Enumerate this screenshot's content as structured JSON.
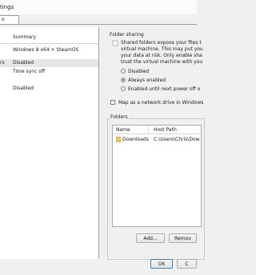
{
  "window": {
    "title": "tings"
  },
  "tabs": [
    {
      "label": "o"
    }
  ],
  "left_panel": {
    "header": "Summary",
    "rows": [
      {
        "key": "",
        "value": "Windows 8 x64 + SteamOS"
      },
      {
        "key": "rs",
        "value": "Disabled"
      },
      {
        "key": "",
        "value": "Time sync off"
      },
      {
        "key": "",
        "value": "Disabled"
      }
    ]
  },
  "folder_sharing": {
    "title": "Folder sharing",
    "description": [
      "Shared folders expose your files t",
      "virtual machine. This may put you",
      "your data at risk. Only enable sha",
      "trust the virtual machine with you"
    ],
    "options": [
      {
        "label": "Disabled",
        "selected": false
      },
      {
        "label": "Always enabled",
        "selected": true
      },
      {
        "label": "Enabled until next power off o",
        "selected": false
      }
    ],
    "map_network_drive": {
      "label": "Map as a network drive in Windows",
      "checked": false
    }
  },
  "folders": {
    "title": "Folders",
    "columns": [
      "Name",
      "Host Path"
    ],
    "rows": [
      {
        "name": "Downloads",
        "host_path": "C:\\Users\\Chris\\Dow"
      }
    ],
    "add_button": "Add...",
    "remove_button": "Remov"
  },
  "footer": {
    "ok_label": "OK",
    "cancel_label": "C"
  }
}
